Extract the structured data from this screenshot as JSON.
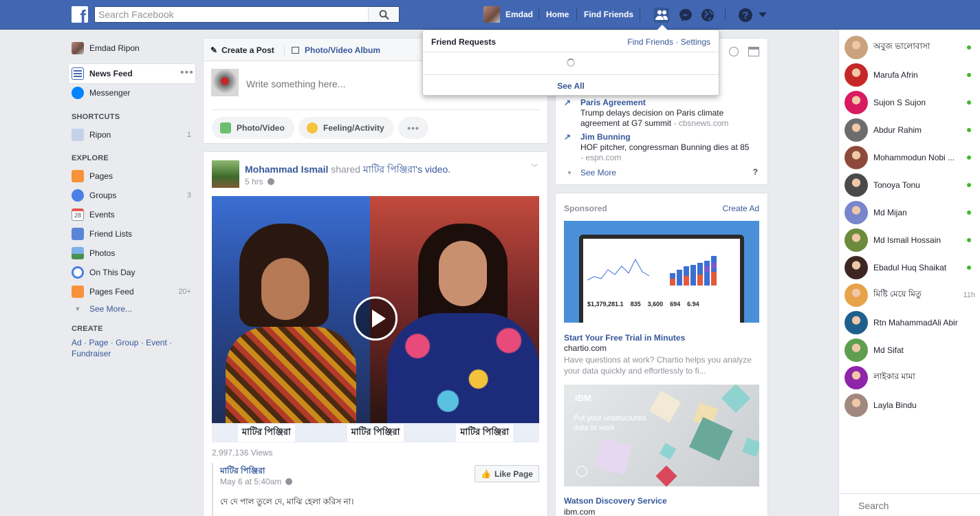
{
  "topbar": {
    "search_placeholder": "Search Facebook",
    "user_name": "Emdad",
    "home": "Home",
    "find_friends": "Find Friends"
  },
  "friend_requests": {
    "title": "Friend Requests",
    "find_friends": "Find Friends",
    "sep": "·",
    "settings": "Settings",
    "see_all": "See All"
  },
  "left_nav": {
    "profile": "Emdad Ripon",
    "news_feed": "News Feed",
    "messenger": "Messenger",
    "shortcuts_heading": "SHORTCUTS",
    "shortcut_ripon": "Ripon",
    "shortcut_ripon_count": "1",
    "explore_heading": "EXPLORE",
    "pages": "Pages",
    "groups": "Groups",
    "groups_count": "3",
    "events": "Events",
    "events_date": "28",
    "friend_lists": "Friend Lists",
    "photos": "Photos",
    "on_this_day": "On This Day",
    "pages_feed": "Pages Feed",
    "pages_feed_count": "20+",
    "see_more": "See More...",
    "create_heading": "CREATE",
    "create_links": [
      "Ad",
      "Page",
      "Group",
      "Event",
      "Fundraiser"
    ]
  },
  "composer": {
    "create_post": "Create a Post",
    "photo_video_album": "Photo/Video Album",
    "placeholder": "Write something here...",
    "photo_video": "Photo/Video",
    "feeling": "Feeling/Activity"
  },
  "post": {
    "author": "Mohammad Ismail",
    "shared": "shared",
    "page": "মাটির পিঞ্জিরা",
    "video_suffix": "'s video.",
    "time": "5 hrs",
    "watermark": "মাটির পিঞ্জিরা",
    "views": "2,997,136 Views",
    "inner_page": "মাটির পিঞ্জিরা",
    "inner_time": "May 6 at 5:40am",
    "like_page": "Like Page",
    "text": "দে দে পাল তুলে দে, মাঝি হেলা করিস না।"
  },
  "trending": {
    "items": [
      {
        "title": "Paris Agreement",
        "line1": "Trump delays decision on Paris climate",
        "line2": "agreement at G7 summit",
        "source": " - cbsnews.com"
      },
      {
        "title": "Jim Bunning",
        "line1": "HOF pitcher, congressman Bunning dies at 85",
        "line2": "",
        "source": "- espn.com"
      }
    ],
    "see_more": "See More",
    "help": "?"
  },
  "sponsored": {
    "heading": "Sponsored",
    "create_ad": "Create Ad",
    "ad1": {
      "title": "Start Your Free Trial in Minutes",
      "domain": "chartio.com",
      "desc": "Have questions at work? Chartio helps you analyze your data quickly and effortlessly to fi...",
      "stats": [
        "$1,379,281.1",
        "835",
        "3,600",
        "694",
        "6.94"
      ]
    },
    "ad2": {
      "brand": "IBM",
      "tagline": "Put your unstructured data to work",
      "title": "Watson Discovery Service",
      "domain": "ibm.com"
    }
  },
  "chat": {
    "contacts": [
      {
        "name": "অবুজ ভালোবাসা",
        "online": true,
        "time": "",
        "color": "#c9a27e"
      },
      {
        "name": "Marufa Afrin",
        "online": true,
        "time": "",
        "color": "#c62828"
      },
      {
        "name": "Sujon S Sujon",
        "online": true,
        "time": "",
        "color": "#d81b60"
      },
      {
        "name": "Abdur Rahim",
        "online": true,
        "time": "",
        "color": "#6d6d6d"
      },
      {
        "name": "Mohammodun Nobi ...",
        "online": true,
        "time": "",
        "color": "#8d4a3b"
      },
      {
        "name": "Tonoya Tonu",
        "online": true,
        "time": "",
        "color": "#4a4a4a"
      },
      {
        "name": "Md Mijan",
        "online": true,
        "time": "",
        "color": "#7986cb"
      },
      {
        "name": "Md Ismail Hossain",
        "online": true,
        "time": "",
        "color": "#6d8b3c"
      },
      {
        "name": "Ebadul Huq Shaikat",
        "online": true,
        "time": "",
        "color": "#3e2723"
      },
      {
        "name": "মিষ্টি মেয়ে মিতু",
        "online": false,
        "time": "11h",
        "color": "#e6a34a"
      },
      {
        "name": "Rtn MahammadAli Abir",
        "online": false,
        "time": "",
        "color": "#1e5f8b"
      },
      {
        "name": "Md Sifat",
        "online": false,
        "time": "",
        "color": "#5f9e50"
      },
      {
        "name": "লাইকার মামা",
        "online": false,
        "time": "",
        "color": "#8e24aa"
      },
      {
        "name": "Layla Bindu",
        "online": false,
        "time": "",
        "color": "#a1887f"
      }
    ],
    "search_placeholder": "Search"
  },
  "colors": {
    "brand": "#4267b2",
    "link": "#365899",
    "online": "#42b72a"
  }
}
